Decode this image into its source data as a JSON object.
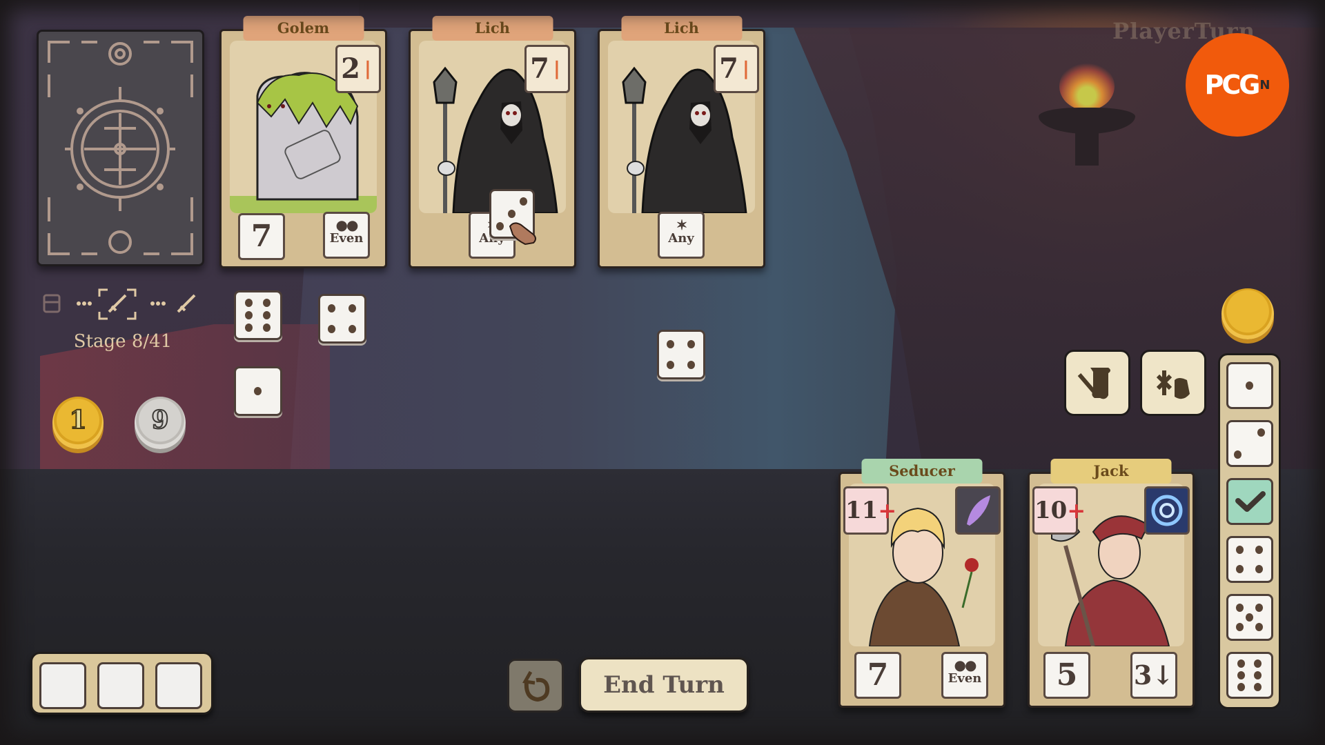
{
  "turn_indicator": "PlayerTurn",
  "watermark": "PCG",
  "watermark_sup": "N",
  "stage": {
    "label": "Stage 8/41",
    "current": 8,
    "total": 41,
    "path_icons": [
      "chest-icon",
      "current-battle-sword-icon",
      "next-battle-sword-icon"
    ]
  },
  "currency": {
    "gold_coin": "1",
    "silver_coin": "9"
  },
  "enemies": [
    {
      "name": "Golem",
      "attack": "2",
      "attack_icon": "attack-pin-icon",
      "health": "7",
      "condition": "Even",
      "condition_symbol": "●●"
    },
    {
      "name": "Lich",
      "attack": "7",
      "attack_icon": "attack-pin-icon",
      "health": "",
      "condition": "Any",
      "condition_symbol": "✶"
    },
    {
      "name": "Lich",
      "attack": "7",
      "attack_icon": "attack-pin-icon",
      "health": "",
      "condition": "Any",
      "condition_symbol": "✶"
    }
  ],
  "dragged_die": {
    "value": 3
  },
  "table_dice": [
    {
      "value": 6
    },
    {
      "value": 4
    },
    {
      "value": 1
    },
    {
      "value": 4
    }
  ],
  "heroes": [
    {
      "name": "Seducer",
      "health": "11",
      "health_symbol": "+",
      "skill_icon": "purple-feather-icon",
      "attack": "7",
      "condition": "Even",
      "condition_symbol": "●●"
    },
    {
      "name": "Jack",
      "health": "10",
      "health_symbol": "+",
      "skill_icon": "blue-vortex-icon",
      "attack": "5",
      "condition": "3↓",
      "condition_symbol": ""
    }
  ],
  "dice_rack": [
    {
      "value": 1,
      "used": false
    },
    {
      "value": 2,
      "used": false
    },
    {
      "value": 3,
      "used": true
    },
    {
      "value": 4,
      "used": false
    },
    {
      "value": 5,
      "used": false
    },
    {
      "value": 6,
      "used": false
    }
  ],
  "actions": {
    "scroll_button": "scroll-quill-icon",
    "inventory_button": "herb-pouch-icon",
    "undo_button": "undo-icon",
    "end_turn_label": "End Turn"
  },
  "reserve_slots": 3,
  "colors": {
    "accent_watermark": "#f15a0c",
    "card_bg": "#d3bd92",
    "enemy_title": "#e0a47a",
    "seducer_title": "#a9d4ad",
    "jack_title": "#e6cc7c",
    "used_die": "#9fd7be"
  }
}
